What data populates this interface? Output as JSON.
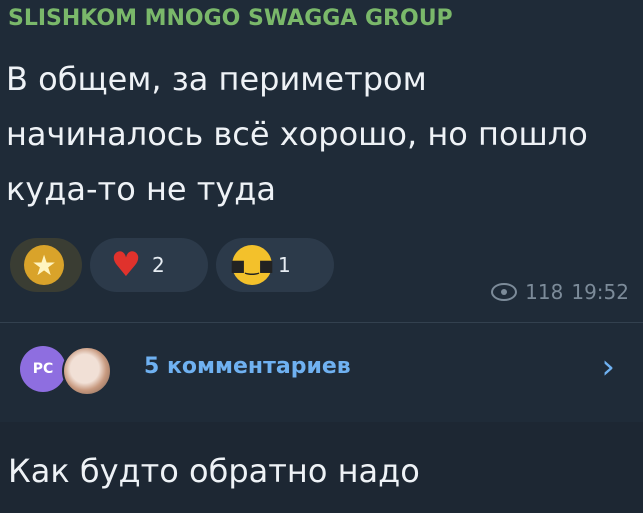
{
  "message": {
    "sender": "SLISHKOM MNOGO SWAGGA GROUP",
    "text": "В общем, за периметром начиналось всё хорошо, но пошло куда-то не туда",
    "reactions": [
      {
        "icon": "star-icon",
        "count": ""
      },
      {
        "icon": "heart-on-fire-icon",
        "count": "2"
      },
      {
        "icon": "smiling-face-with-sunglasses-icon",
        "count": "1"
      }
    ],
    "views": "118",
    "time": "19:52"
  },
  "comments": {
    "avatar_initials": "PC",
    "label": "5 комментариев"
  },
  "next_message": {
    "text": "Как будто обратно надо"
  },
  "colors": {
    "background": "#1d2733",
    "sender": "#7ab86a",
    "link": "#6fb1f1",
    "avatar": "#8e6ee0"
  }
}
